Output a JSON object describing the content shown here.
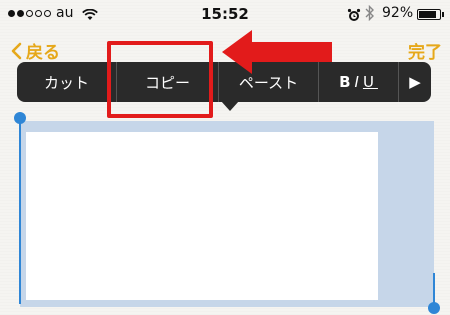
{
  "status_bar": {
    "carrier": "au",
    "time": "15:52",
    "battery_text": "92%",
    "battery_level": 0.92,
    "icons": [
      "signal-dots-icon",
      "wifi-icon",
      "alarm-icon",
      "bluetooth-icon",
      "battery-icon"
    ]
  },
  "nav": {
    "back_label": "戻る",
    "done_label": "完了"
  },
  "edit_menu": {
    "items": [
      {
        "label": "カット"
      },
      {
        "label": "コピー"
      },
      {
        "label": "ペースト"
      },
      {
        "label": "BIU"
      },
      {
        "label": "▶"
      }
    ]
  },
  "annotation": {
    "highlight_color": "#e21b1b",
    "highlighted_item": "コピー"
  },
  "colors": {
    "accent": "#e6a81a",
    "selection": "#c6d6e9",
    "handle": "#2f86d6",
    "menu_bg": "#2a2a2a"
  }
}
